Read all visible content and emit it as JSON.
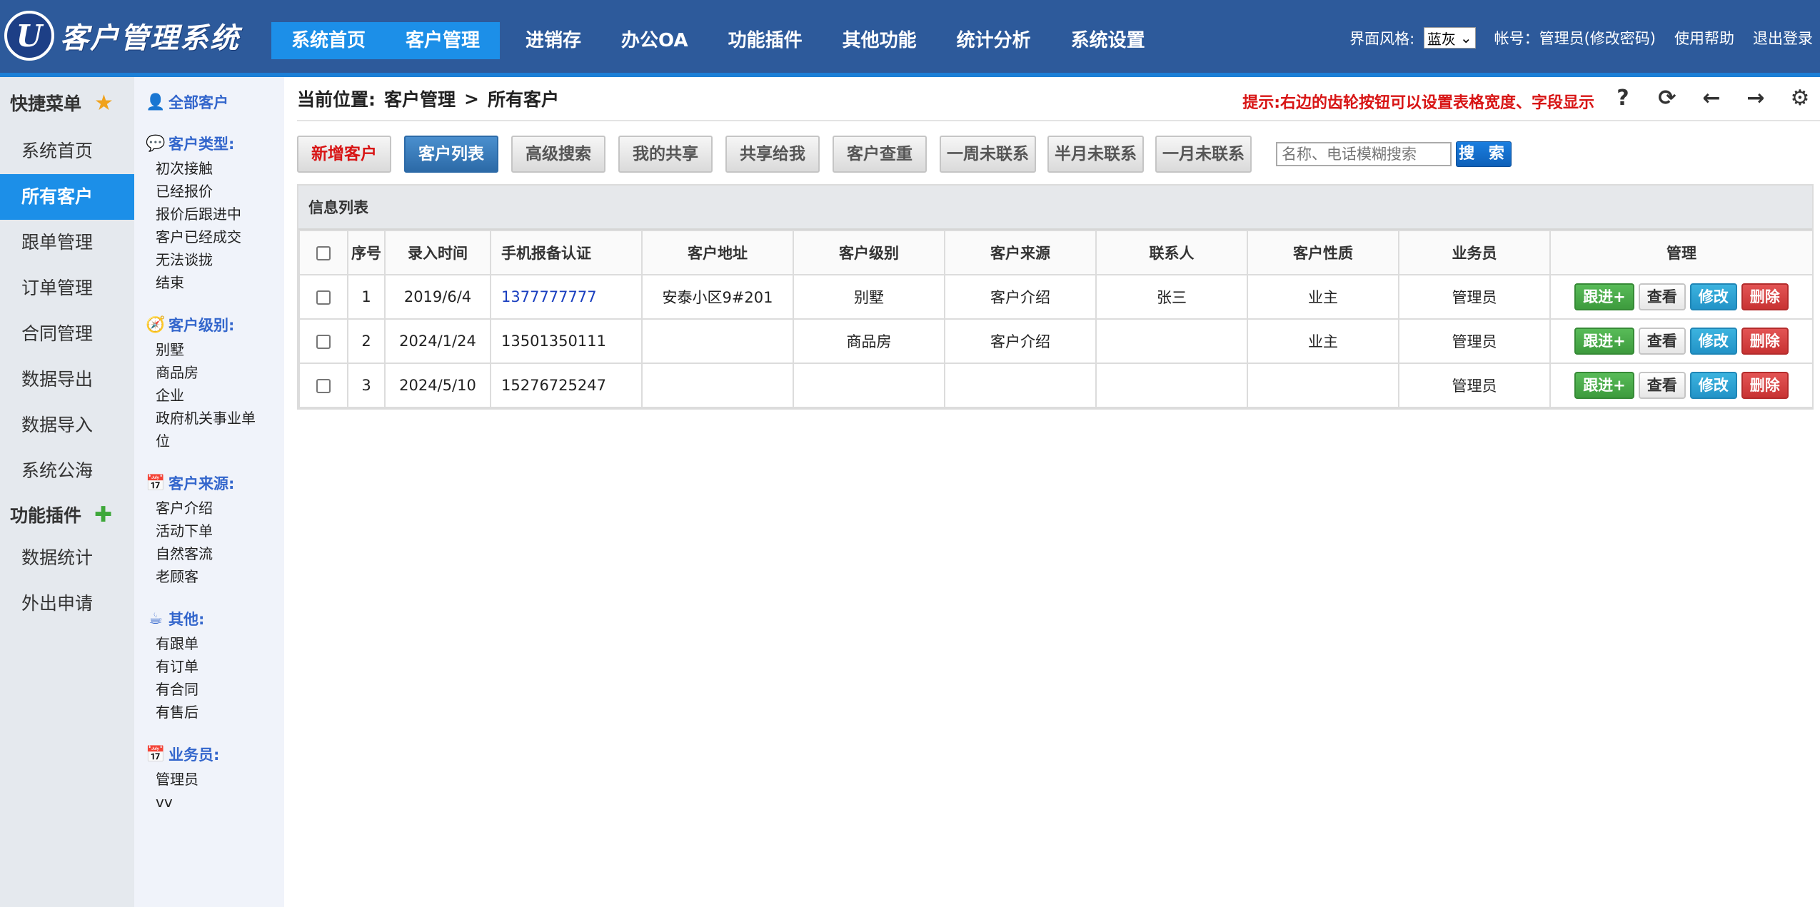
{
  "app": {
    "logo_letter": "U",
    "title": "客户管理系统"
  },
  "nav": [
    {
      "label": "系统首页",
      "active": true
    },
    {
      "label": "客户管理",
      "active": true
    },
    {
      "label": "进销存",
      "active": false
    },
    {
      "label": "办公OA",
      "active": false
    },
    {
      "label": "功能插件",
      "active": false
    },
    {
      "label": "其他功能",
      "active": false
    },
    {
      "label": "统计分析",
      "active": false
    },
    {
      "label": "系统设置",
      "active": false
    }
  ],
  "topright": {
    "style_label": "界面风格:",
    "style_value": "蓝灰",
    "account": "帐号：管理员(修改密码)",
    "help": "使用帮助",
    "logout": "退出登录"
  },
  "sidebar": {
    "quick_menu": "快捷菜单",
    "items": [
      "系统首页",
      "所有客户",
      "跟单管理",
      "订单管理",
      "合同管理",
      "数据导出",
      "数据导入",
      "系统公海"
    ],
    "plugins": "功能插件",
    "plugin_items": [
      "数据统计",
      "外出申请"
    ]
  },
  "filter": {
    "all": "全部客户",
    "type_title": "客户类型:",
    "types": [
      "初次接触",
      "已经报价",
      "报价后跟进中",
      "客户已经成交",
      "无法谈拢",
      "结束"
    ],
    "level_title": "客户级别:",
    "levels": [
      "别墅",
      "商品房",
      "企业",
      "政府机关事业单位"
    ],
    "source_title": "客户来源:",
    "sources": [
      "客户介绍",
      "活动下单",
      "自然客流",
      "老顾客"
    ],
    "other_title": "其他:",
    "others": [
      "有跟单",
      "有订单",
      "有合同",
      "有售后"
    ],
    "sales_title": "业务员:",
    "sales": [
      "管理员",
      "vv"
    ]
  },
  "breadcrumb": {
    "prefix": "当前位置:",
    "level1": "客户管理",
    "sep": ">",
    "level2": "所有客户"
  },
  "tip": "提示:右边的齿轮按钮可以设置表格宽度、字段显示",
  "toolbar": {
    "buttons": [
      "新增客户",
      "客户列表",
      "高级搜索",
      "我的共享",
      "共享给我",
      "客户查重",
      "一周未联系",
      "半月未联系",
      "一月未联系"
    ],
    "search_placeholder": "名称、电话模糊搜索",
    "search_button": "搜 索"
  },
  "list": {
    "title": "信息列表",
    "columns": [
      "序号",
      "录入时间",
      "手机报备认证",
      "客户地址",
      "客户级别",
      "客户来源",
      "联系人",
      "客户性质",
      "业务员",
      "管理"
    ],
    "rows": [
      {
        "no": "1",
        "date": "2019/6/4",
        "phone": "1377777777",
        "address": "安泰小区9#201",
        "level": "别墅",
        "source": "客户介绍",
        "contact": "张三",
        "nature": "业主",
        "sales": "管理员"
      },
      {
        "no": "2",
        "date": "2024/1/24",
        "phone": "13501350111",
        "address": "",
        "level": "商品房",
        "source": "客户介绍",
        "contact": "",
        "nature": "业主",
        "sales": "管理员"
      },
      {
        "no": "3",
        "date": "2024/5/10",
        "phone": "15276725247",
        "address": "",
        "level": "",
        "source": "",
        "contact": "",
        "nature": "",
        "sales": "管理员"
      }
    ],
    "actions": {
      "follow": "跟进+",
      "view": "查看",
      "edit": "修改",
      "delete": "删除"
    }
  }
}
